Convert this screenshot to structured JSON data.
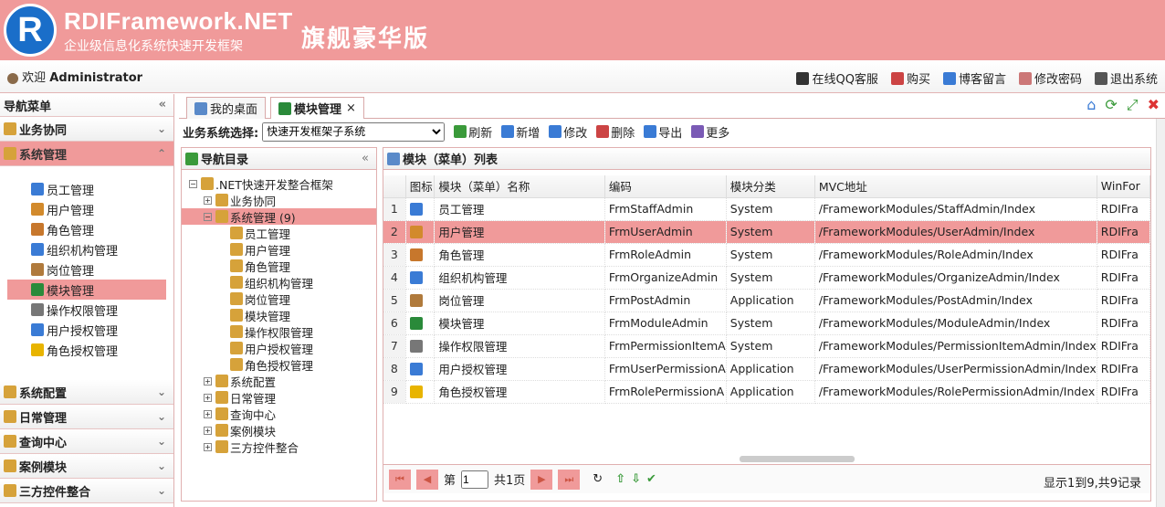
{
  "header": {
    "logo_letter": "R",
    "brand": "RDIFramework.NET",
    "subtitle": "企业级信息化系统快速开发框架",
    "edition": "旗舰豪华版"
  },
  "topbar": {
    "welcome_prefix": "欢迎",
    "user": "Administrator",
    "links": [
      {
        "label": "在线QQ客服",
        "icon": "qq-icon",
        "color": "#333"
      },
      {
        "label": "购买",
        "icon": "cart-icon",
        "color": "#c44"
      },
      {
        "label": "博客留言",
        "icon": "mail-icon",
        "color": "#3a7bd5"
      },
      {
        "label": "修改密码",
        "icon": "edit-icon",
        "color": "#c77"
      },
      {
        "label": "退出系统",
        "icon": "logout-icon",
        "color": "#555"
      }
    ]
  },
  "left": {
    "title": "导航菜单",
    "collapse": "«",
    "groups_top": [
      {
        "label": "业务协同",
        "chev": "⌄"
      },
      {
        "label": "系统管理",
        "chev": "⌃",
        "active": true
      }
    ],
    "items": [
      {
        "label": "员工管理",
        "icon": "staff-icon",
        "color": "#3a7bd5"
      },
      {
        "label": "用户管理",
        "icon": "user-icon",
        "color": "#d28a2c"
      },
      {
        "label": "角色管理",
        "icon": "role-icon",
        "color": "#c7772c"
      },
      {
        "label": "组织机构管理",
        "icon": "org-icon",
        "color": "#3a7bd5"
      },
      {
        "label": "岗位管理",
        "icon": "post-icon",
        "color": "#b07a3c"
      },
      {
        "label": "模块管理",
        "icon": "module-icon",
        "color": "#2a8a3a",
        "selected": true
      },
      {
        "label": "操作权限管理",
        "icon": "permission-icon",
        "color": "#777"
      },
      {
        "label": "用户授权管理",
        "icon": "user-auth-icon",
        "color": "#3a7bd5"
      },
      {
        "label": "角色授权管理",
        "icon": "lightning-icon",
        "color": "#e8b400"
      }
    ],
    "groups_bottom": [
      {
        "label": "系统配置",
        "chev": "⌄"
      },
      {
        "label": "日常管理",
        "chev": "⌄"
      },
      {
        "label": "查询中心",
        "chev": "⌄"
      },
      {
        "label": "案例模块",
        "chev": "⌄"
      },
      {
        "label": "三方控件整合",
        "chev": "⌄"
      }
    ]
  },
  "tabs": [
    {
      "label": "我的桌面",
      "icon": "desktop-icon"
    },
    {
      "label": "模块管理",
      "icon": "module-icon",
      "active": true,
      "close": "×"
    }
  ],
  "toolbar": {
    "system_label": "业务系统选择:",
    "system_value": "快速开发框架子系统",
    "buttons": [
      {
        "label": "刷新",
        "icon": "refresh-icon",
        "color": "#3a9a3a"
      },
      {
        "label": "新增",
        "icon": "add-icon",
        "color": "#3a7bd5"
      },
      {
        "label": "修改",
        "icon": "edit-icon",
        "color": "#3a7bd5"
      },
      {
        "label": "删除",
        "icon": "delete-icon",
        "color": "#c44"
      },
      {
        "label": "导出",
        "icon": "export-icon",
        "color": "#3a7bd5"
      },
      {
        "label": "更多",
        "icon": "more-icon",
        "color": "#7a5ab5"
      }
    ]
  },
  "tree": {
    "title": "导航目录",
    "collapse": "«",
    "nodes": [
      {
        "label": ".NET快速开发整合框架",
        "level": 0,
        "pm": "−",
        "icon": "net-icon"
      },
      {
        "label": "业务协同",
        "level": 1,
        "pm": "+",
        "icon": "handshake-icon"
      },
      {
        "label": "系统管理 (9)",
        "level": 1,
        "pm": "−",
        "icon": "box-icon",
        "selected": true
      },
      {
        "label": "员工管理",
        "level": 2,
        "icon": "staff-icon"
      },
      {
        "label": "用户管理",
        "level": 2,
        "icon": "user-icon"
      },
      {
        "label": "角色管理",
        "level": 2,
        "icon": "role-icon"
      },
      {
        "label": "组织机构管理",
        "level": 2,
        "icon": "org-icon"
      },
      {
        "label": "岗位管理",
        "level": 2,
        "icon": "post-icon"
      },
      {
        "label": "模块管理",
        "level": 2,
        "icon": "module-icon"
      },
      {
        "label": "操作权限管理",
        "level": 2,
        "icon": "permission-icon"
      },
      {
        "label": "用户授权管理",
        "level": 2,
        "icon": "user-auth-icon"
      },
      {
        "label": "角色授权管理",
        "level": 2,
        "icon": "lightning-icon"
      },
      {
        "label": "系统配置",
        "level": 1,
        "pm": "+",
        "icon": "wrench-icon"
      },
      {
        "label": "日常管理",
        "level": 1,
        "pm": "+",
        "icon": "calendar-icon"
      },
      {
        "label": "查询中心",
        "level": 1,
        "pm": "+",
        "icon": "book-icon"
      },
      {
        "label": "案例模块",
        "level": 1,
        "pm": "+",
        "icon": "folder-icon"
      },
      {
        "label": "三方控件整合",
        "level": 1,
        "pm": "+",
        "icon": "plugin-icon"
      }
    ]
  },
  "grid": {
    "title": "模块（菜单）列表",
    "columns": [
      "",
      "图标",
      "模块（菜单）名称",
      "编码",
      "模块分类",
      "MVC地址",
      "WinFor"
    ],
    "rows": [
      {
        "n": "1",
        "name": "员工管理",
        "code": "FrmStaffAdmin",
        "cat": "System",
        "mvc": "/FrameworkModules/StaffAdmin/Index",
        "win": "RDIFra",
        "icon": "staff-icon",
        "color": "#3a7bd5"
      },
      {
        "n": "2",
        "name": "用户管理",
        "code": "FrmUserAdmin",
        "cat": "System",
        "mvc": "/FrameworkModules/UserAdmin/Index",
        "win": "RDIFra",
        "icon": "user-icon",
        "color": "#d28a2c",
        "selected": true
      },
      {
        "n": "3",
        "name": "角色管理",
        "code": "FrmRoleAdmin",
        "cat": "System",
        "mvc": "/FrameworkModules/RoleAdmin/Index",
        "win": "RDIFra",
        "icon": "role-icon",
        "color": "#c7772c"
      },
      {
        "n": "4",
        "name": "组织机构管理",
        "code": "FrmOrganizeAdmin",
        "cat": "System",
        "mvc": "/FrameworkModules/OrganizeAdmin/Index",
        "win": "RDIFra",
        "icon": "org-icon",
        "color": "#3a7bd5"
      },
      {
        "n": "5",
        "name": "岗位管理",
        "code": "FrmPostAdmin",
        "cat": "Application",
        "mvc": "/FrameworkModules/PostAdmin/Index",
        "win": "RDIFra",
        "icon": "post-icon",
        "color": "#b07a3c"
      },
      {
        "n": "6",
        "name": "模块管理",
        "code": "FrmModuleAdmin",
        "cat": "System",
        "mvc": "/FrameworkModules/ModuleAdmin/Index",
        "win": "RDIFra",
        "icon": "module-icon",
        "color": "#2a8a3a"
      },
      {
        "n": "7",
        "name": "操作权限管理",
        "code": "FrmPermissionItemA",
        "cat": "System",
        "mvc": "/FrameworkModules/PermissionItemAdmin/Index",
        "win": "RDIFra",
        "icon": "permission-icon",
        "color": "#777"
      },
      {
        "n": "8",
        "name": "用户授权管理",
        "code": "FrmUserPermissionA",
        "cat": "Application",
        "mvc": "/FrameworkModules/UserPermissionAdmin/Index",
        "win": "RDIFra",
        "icon": "user-auth-icon",
        "color": "#3a7bd5"
      },
      {
        "n": "9",
        "name": "角色授权管理",
        "code": "FrmRolePermissionA",
        "cat": "Application",
        "mvc": "/FrameworkModules/RolePermissionAdmin/Index",
        "win": "RDIFra",
        "icon": "lightning-icon",
        "color": "#e8b400"
      }
    ]
  },
  "pager": {
    "page_prefix": "第",
    "page_value": "1",
    "total_pages": "共1页",
    "info": "显示1到9,共9记录"
  },
  "colors": {
    "accent": "#f09a9a",
    "border": "#e0b0b0"
  }
}
